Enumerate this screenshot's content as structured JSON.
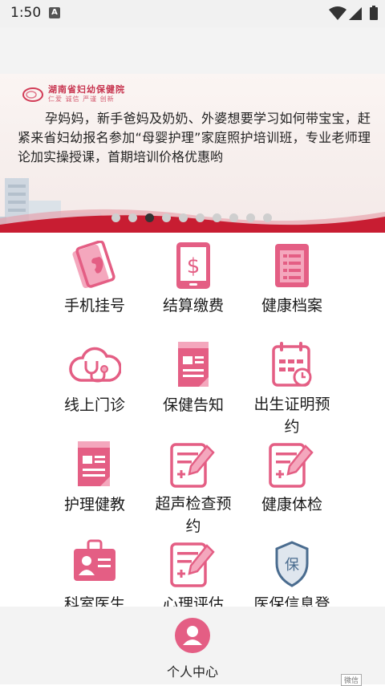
{
  "status": {
    "time": "1:50",
    "notification_badge": "A"
  },
  "banner": {
    "logo_title": "湖南省妇幼保健院",
    "logo_sub": "仁爱 诚信 严谨 创新",
    "text": "孕妈妈，新手爸妈及奶奶、外婆想要学习如何带宝宝，赶紧来省妇幼报名参加“母婴护理”家庭照护培训班，专业老师理论加实操授课，首期培训价格优惠哟",
    "slide_count": 10,
    "active_slide": 3
  },
  "menu": [
    {
      "label": "手机挂号",
      "icon": "phone-icon"
    },
    {
      "label": "结算缴费",
      "icon": "payment-icon"
    },
    {
      "label": "健康档案",
      "icon": "document-icon"
    },
    {
      "label": "线上门诊",
      "icon": "stethoscope-cloud-icon"
    },
    {
      "label": "保健告知",
      "icon": "notice-icon"
    },
    {
      "label": "出生证明预约",
      "icon": "calendar-icon"
    },
    {
      "label": "护理健教",
      "icon": "clipboard-icon"
    },
    {
      "label": "超声检查预约",
      "icon": "edit-record-icon"
    },
    {
      "label": "健康体检",
      "icon": "edit-record-icon"
    },
    {
      "label": "科室医生",
      "icon": "id-badge-icon"
    },
    {
      "label": "心理评估",
      "icon": "edit-record-icon"
    },
    {
      "label": "医保信息登",
      "icon": "insurance-shield-icon"
    }
  ],
  "bottom_nav": {
    "label": "个人中心",
    "icon": "user-icon"
  },
  "corner_badge": "微信",
  "colors": {
    "accent": "#e45e84",
    "accent_light": "#f4a7bd",
    "banner_red": "#c81d32",
    "shield": "#4a6c8f"
  }
}
